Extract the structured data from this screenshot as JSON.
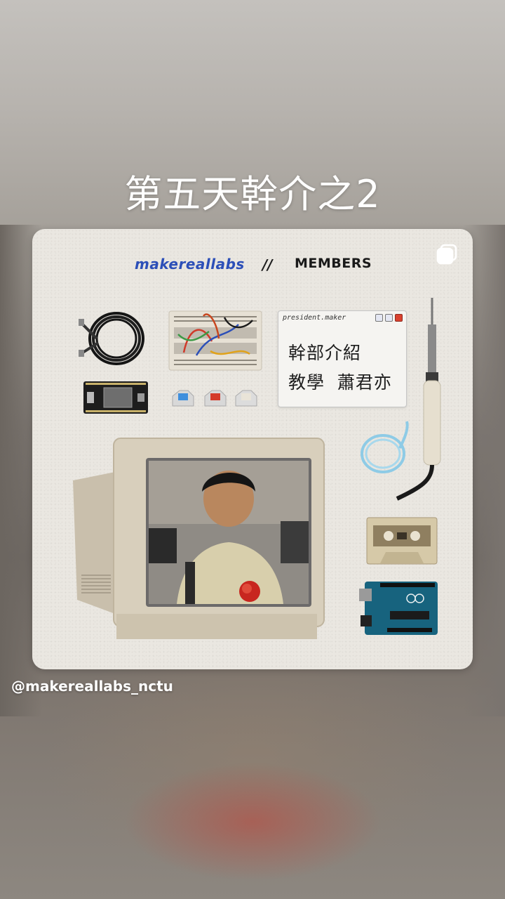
{
  "story": {
    "headline": "第五天幹介之2",
    "mention": "@makereallabs_nctu"
  },
  "post": {
    "brand": "makereallabs",
    "separator": "//",
    "section": "MEMBERS",
    "window": {
      "title": "president.maker",
      "line1": "幹部介紹",
      "line2": "教學  蕭君亦"
    }
  },
  "colors": {
    "brand_blue": "#2c4fb8",
    "card_bg": "#eae7e1",
    "rose_red": "#c8261f"
  },
  "icons": [
    "multi-photo-icon",
    "cable-icon",
    "breadboard-icon",
    "keycap-icon",
    "soldering-iron-icon",
    "esp32-board-icon",
    "crt-monitor-icon",
    "cassette-icon",
    "arduino-board-icon"
  ]
}
